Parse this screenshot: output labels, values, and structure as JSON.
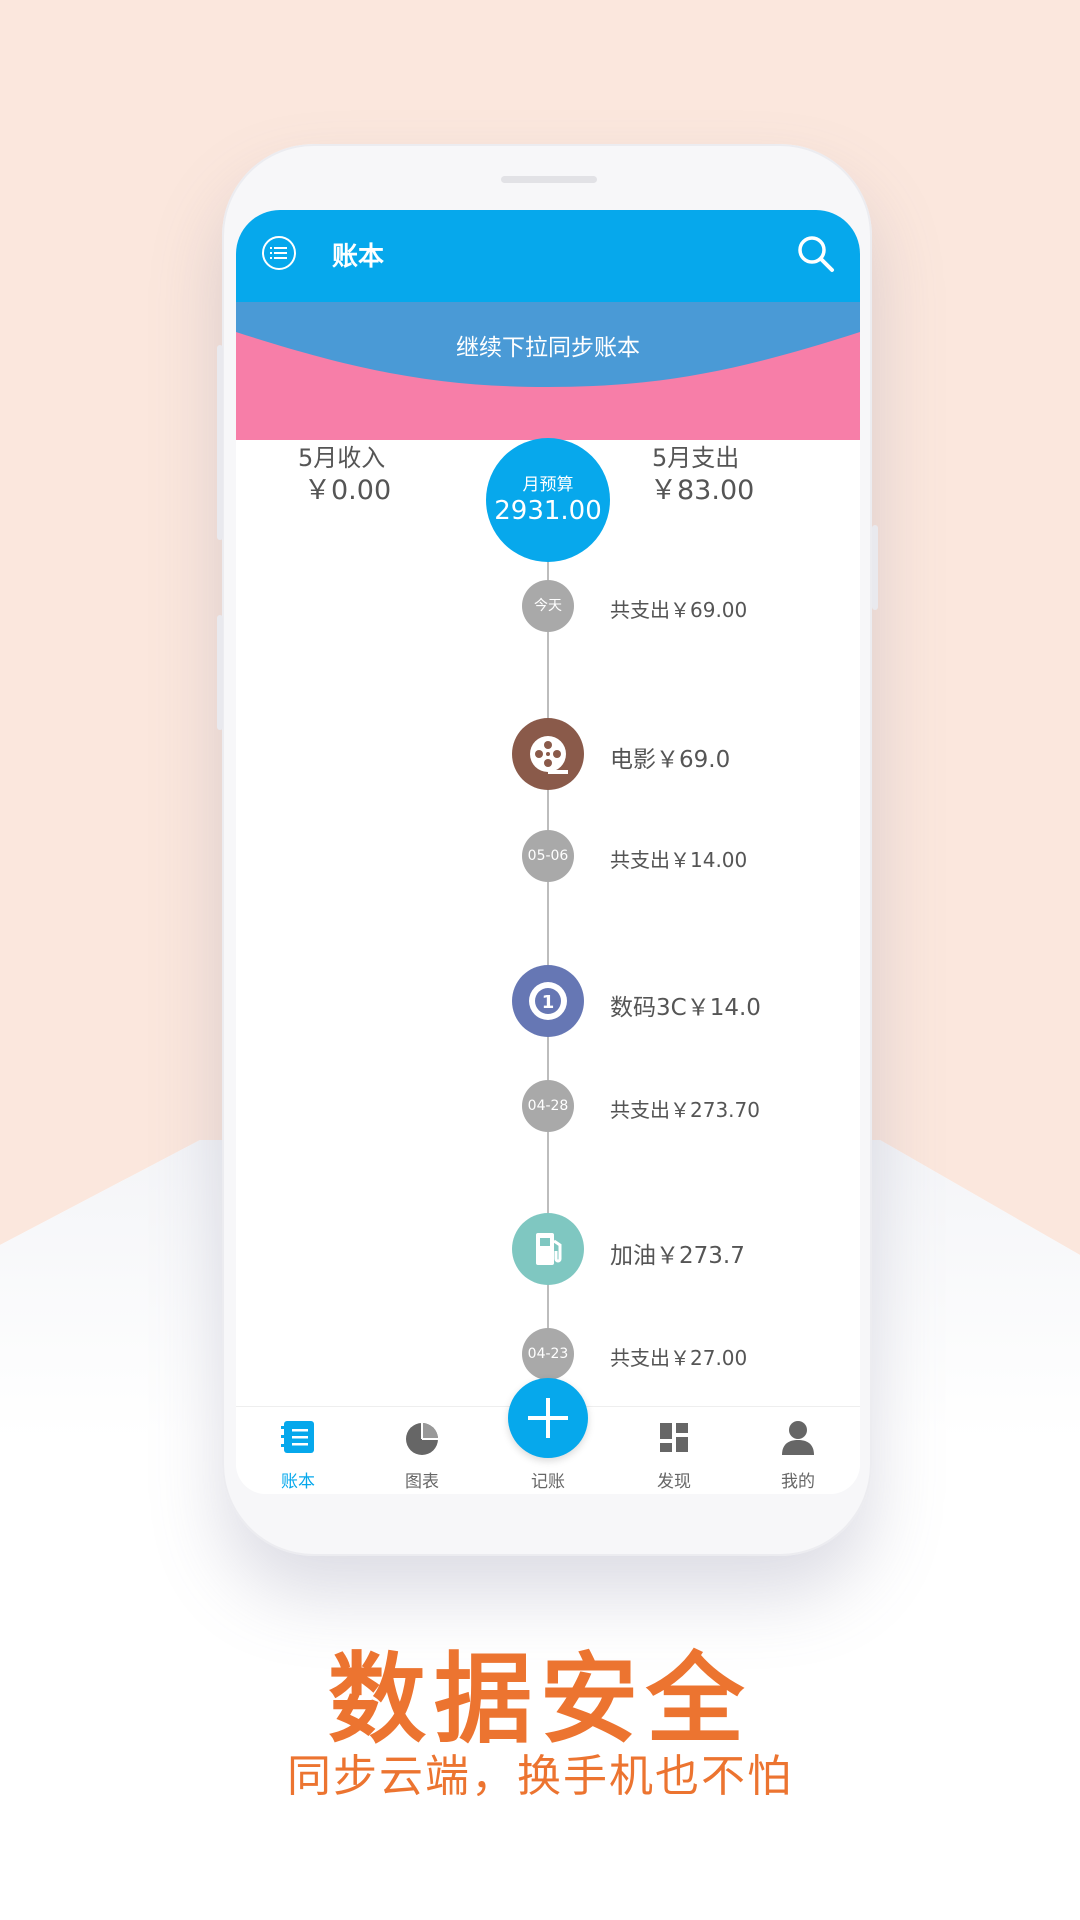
{
  "colors": {
    "brand_blue": "#06a8ec",
    "banner_blue": "#4a9ad6",
    "banner_pink": "#f77ea8",
    "accent_orange": "#ec7430",
    "movie_brown": "#8a5a4a",
    "digital_indigo": "#6677b4",
    "fuel_teal": "#7fc7c1"
  },
  "app_bar": {
    "menu_icon": "list-icon",
    "title": "账本",
    "search_icon": "search-icon"
  },
  "sync_banner": {
    "text": "继续下拉同步账本"
  },
  "summary": {
    "income_label": "5月收入",
    "income_value": "￥0.00",
    "budget_label": "月预算",
    "budget_value": "2931.00",
    "expense_label": "5月支出",
    "expense_value": "￥83.00"
  },
  "timeline": [
    {
      "date": "今天",
      "total": "共支出￥69.00",
      "item": "电影￥69.0",
      "icon": "film-reel-icon"
    },
    {
      "date": "05-06",
      "total": "共支出￥14.00",
      "item": "数码3C￥14.0",
      "icon": "digital-icon"
    },
    {
      "date": "04-28",
      "total": "共支出￥273.70",
      "item": "加油￥273.7",
      "icon": "fuel-pump-icon"
    },
    {
      "date": "04-23",
      "total": "共支出￥27.00"
    }
  ],
  "tabs": [
    {
      "label": "账本",
      "icon": "ledger-icon",
      "active": true
    },
    {
      "label": "图表",
      "icon": "pie-chart-icon",
      "active": false
    },
    {
      "label": "记账",
      "icon": "plus-icon",
      "active": false
    },
    {
      "label": "发现",
      "icon": "grid-icon",
      "active": false
    },
    {
      "label": "我的",
      "icon": "user-icon",
      "active": false
    }
  ],
  "promo": {
    "headline": "数据安全",
    "subline": "同步云端，换手机也不怕"
  }
}
